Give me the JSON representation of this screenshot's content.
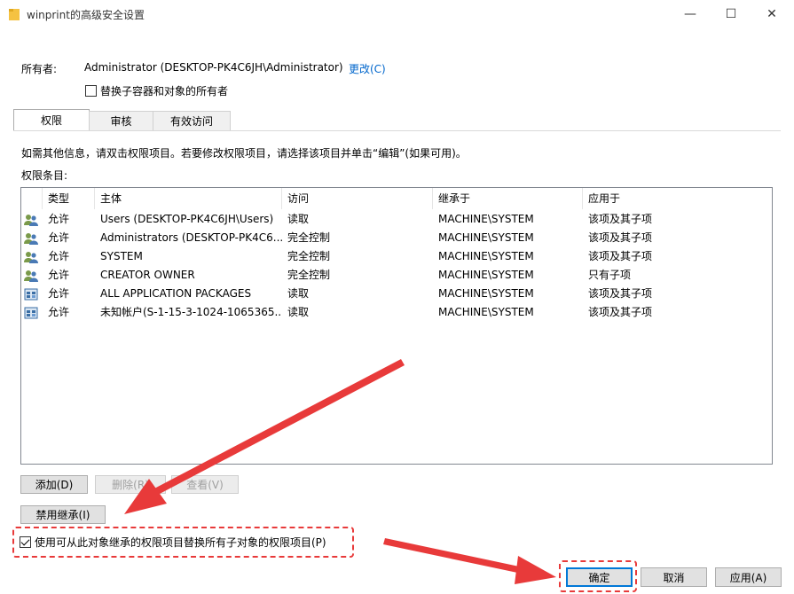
{
  "window": {
    "title": "winprint的高级安全设置",
    "folder_icon": "folder-icon",
    "controls": {
      "minimize": "—",
      "maximize": "☐",
      "close": "✕"
    }
  },
  "owner": {
    "label": "所有者:",
    "value": "Administrator (DESKTOP-PK4C6JH\\Administrator)",
    "change_link": "更改(C)",
    "replace_checkbox_label": "替换子容器和对象的所有者",
    "replace_checked": false
  },
  "tabs": [
    {
      "label": "权限",
      "active": true
    },
    {
      "label": "审核",
      "active": false
    },
    {
      "label": "有效访问",
      "active": false
    }
  ],
  "info_text": "如需其他信息，请双击权限项目。若要修改权限项目，请选择该项目并单击“编辑”(如果可用)。",
  "entries_label": "权限条目:",
  "table": {
    "columns": [
      "类型",
      "主体",
      "访问",
      "继承于",
      "应用于"
    ],
    "rows": [
      {
        "icon": "users-icon",
        "type": "允许",
        "principal": "Users (DESKTOP-PK4C6JH\\Users)",
        "access": "读取",
        "inherited": "MACHINE\\SYSTEM",
        "applies": "该项及其子项"
      },
      {
        "icon": "users-icon",
        "type": "允许",
        "principal": "Administrators (DESKTOP-PK4C6...",
        "access": "完全控制",
        "inherited": "MACHINE\\SYSTEM",
        "applies": "该项及其子项"
      },
      {
        "icon": "users-icon",
        "type": "允许",
        "principal": "SYSTEM",
        "access": "完全控制",
        "inherited": "MACHINE\\SYSTEM",
        "applies": "该项及其子项"
      },
      {
        "icon": "users-icon",
        "type": "允许",
        "principal": "CREATOR OWNER",
        "access": "完全控制",
        "inherited": "MACHINE\\SYSTEM",
        "applies": "只有子项"
      },
      {
        "icon": "package-icon",
        "type": "允许",
        "principal": "ALL APPLICATION PACKAGES",
        "access": "读取",
        "inherited": "MACHINE\\SYSTEM",
        "applies": "该项及其子项"
      },
      {
        "icon": "package-icon",
        "type": "允许",
        "principal": "未知帐户(S-1-15-3-1024-1065365...",
        "access": "读取",
        "inherited": "MACHINE\\SYSTEM",
        "applies": "该项及其子项"
      }
    ]
  },
  "buttons": {
    "add": "添加(D)",
    "remove": "删除(R)",
    "view": "查看(V)",
    "disable_inheritance": "禁用继承(I)",
    "ok": "确定",
    "cancel": "取消",
    "apply": "应用(A)"
  },
  "inherit_replace": {
    "label": "使用可从此对象继承的权限项目替换所有子对象的权限项目(P)",
    "checked": true
  },
  "colors": {
    "annotation_red": "#e83a3a",
    "link_blue": "#0066cc",
    "focus_blue": "#0078d7"
  }
}
